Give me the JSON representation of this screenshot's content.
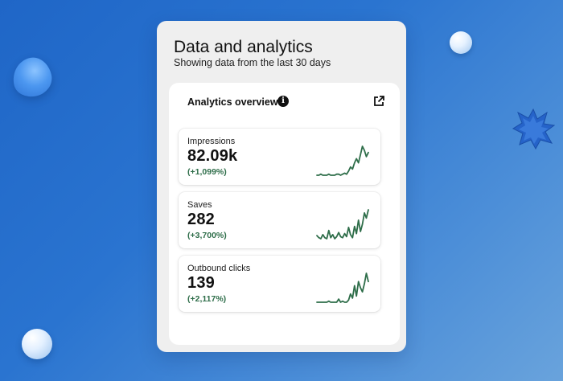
{
  "colors": {
    "background": "#2a74d0",
    "panel": "#efefef",
    "card": "#ffffff",
    "trend_green": "#2f6e4a"
  },
  "panel": {
    "title": "Data and analytics",
    "subtitle": "Showing data from the last 30 days"
  },
  "overview": {
    "title": "Analytics overview",
    "info_icon": "info-icon",
    "link_icon": "external-link-icon"
  },
  "metrics": [
    {
      "label": "Impressions",
      "value": "82.09k",
      "change": "(+1,099%)",
      "trend": [
        2,
        2,
        3,
        2,
        2,
        2,
        3,
        2,
        2,
        2,
        3,
        3,
        2,
        3,
        4,
        3,
        6,
        10,
        8,
        14,
        18,
        14,
        22,
        30,
        26,
        20,
        24
      ]
    },
    {
      "label": "Saves",
      "value": "282",
      "change": "(+3,700%)",
      "trend": [
        5,
        3,
        2,
        6,
        3,
        2,
        10,
        3,
        6,
        2,
        4,
        8,
        4,
        3,
        7,
        4,
        13,
        6,
        3,
        14,
        7,
        20,
        9,
        16,
        27,
        22,
        30
      ]
    },
    {
      "label": "Outbound clicks",
      "value": "139",
      "change": "(+2,117%)",
      "trend": [
        2,
        2,
        2,
        2,
        2,
        2,
        3,
        2,
        2,
        2,
        2,
        5,
        2,
        3,
        2,
        2,
        4,
        10,
        6,
        18,
        8,
        22,
        16,
        12,
        20,
        30,
        22
      ]
    }
  ]
}
